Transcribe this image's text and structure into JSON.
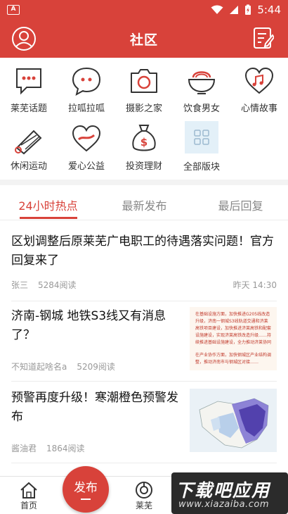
{
  "status_bar": {
    "time": "5:44"
  },
  "header": {
    "title": "社区"
  },
  "categories": [
    {
      "label": "莱芜话题",
      "icon": "speech-bubble-dots-icon"
    },
    {
      "label": "拉呱拉呱",
      "icon": "chat-bubble-icon"
    },
    {
      "label": "摄影之家",
      "icon": "camera-icon"
    },
    {
      "label": "饮食男女",
      "icon": "bowl-icon"
    },
    {
      "label": "心情故事",
      "icon": "heart-music-icon"
    },
    {
      "label": "休闲运动",
      "icon": "shuttlecock-icon"
    },
    {
      "label": "爱心公益",
      "icon": "heart-ribbon-icon"
    },
    {
      "label": "投资理财",
      "icon": "money-bag-icon"
    },
    {
      "label": "全部版块",
      "icon": "grid-icon"
    }
  ],
  "tabs": [
    {
      "label": "24小时热点",
      "active": true
    },
    {
      "label": "最新发布",
      "active": false
    },
    {
      "label": "最后回复",
      "active": false
    }
  ],
  "posts": [
    {
      "title": "区划调整后原莱芜广电职工的待遇落实问题！官方回复来了",
      "author": "张三",
      "reads": "5284阅读",
      "time": "昨天 14:30"
    },
    {
      "title": "济南-钢城 地铁S3线又有消息了？",
      "author": "不知道起啥名a",
      "reads": "5209阅读",
      "time": "",
      "thumb_lines": [
        "在基础设施方面，加快推进G205线改造升级，济南一钢城S3线轨道交通和济莱高铁项目建设，加快推进济莱高铁和配套设施建设，实现济莱高铁改造升级……持续推进基础设施建设，全力推动济莱协同",
        "在产业协作方面，加快钢城区产业结构调整，推动济南市与钢城区对接……"
      ]
    },
    {
      "title": "预警再度升级！寒潮橙色预警发布",
      "author": "酱油君",
      "reads": "1864阅读",
      "time": ""
    }
  ],
  "bottom_nav": {
    "home": "首页",
    "publish": "发布",
    "laiwu": "莱芜"
  },
  "watermark": {
    "main": "下载吧应用",
    "sub": "www.xiazaiba.com"
  },
  "colors": {
    "brand": "#d8423a",
    "muted": "#999999"
  }
}
